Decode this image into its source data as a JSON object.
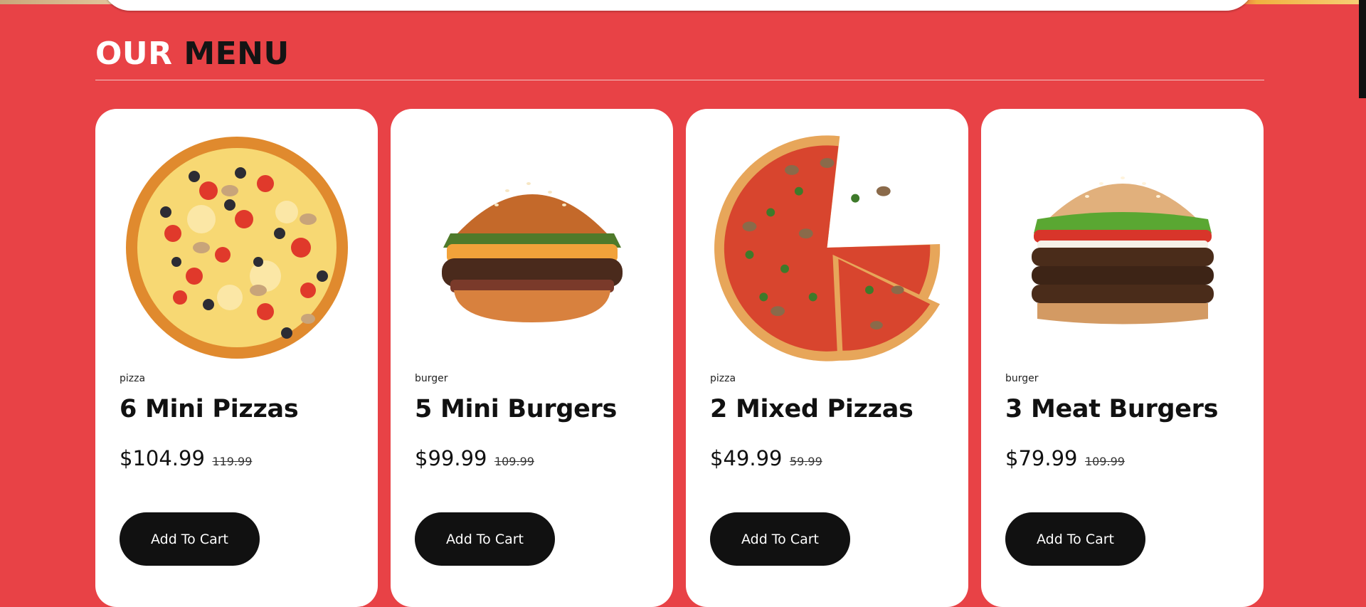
{
  "section": {
    "title_part1": "OUR",
    "title_part2": "MENU"
  },
  "colors": {
    "background": "#e84246",
    "card": "#ffffff",
    "button": "#111111"
  },
  "menu_items": [
    {
      "category": "pizza",
      "name": "6 Mini Pizzas",
      "price": "$104.99",
      "old_price": "119.99",
      "button_label": "Add To Cart",
      "image": "pizza-image"
    },
    {
      "category": "burger",
      "name": "5 Mini Burgers",
      "price": "$99.99",
      "old_price": "109.99",
      "button_label": "Add To Cart",
      "image": "burger-image"
    },
    {
      "category": "pizza",
      "name": "2 Mixed Pizzas",
      "price": "$49.99",
      "old_price": "59.99",
      "button_label": "Add To Cart",
      "image": "pizza-image"
    },
    {
      "category": "burger",
      "name": "3 Meat Burgers",
      "price": "$79.99",
      "old_price": "109.99",
      "button_label": "Add To Cart",
      "image": "burger-image"
    }
  ]
}
